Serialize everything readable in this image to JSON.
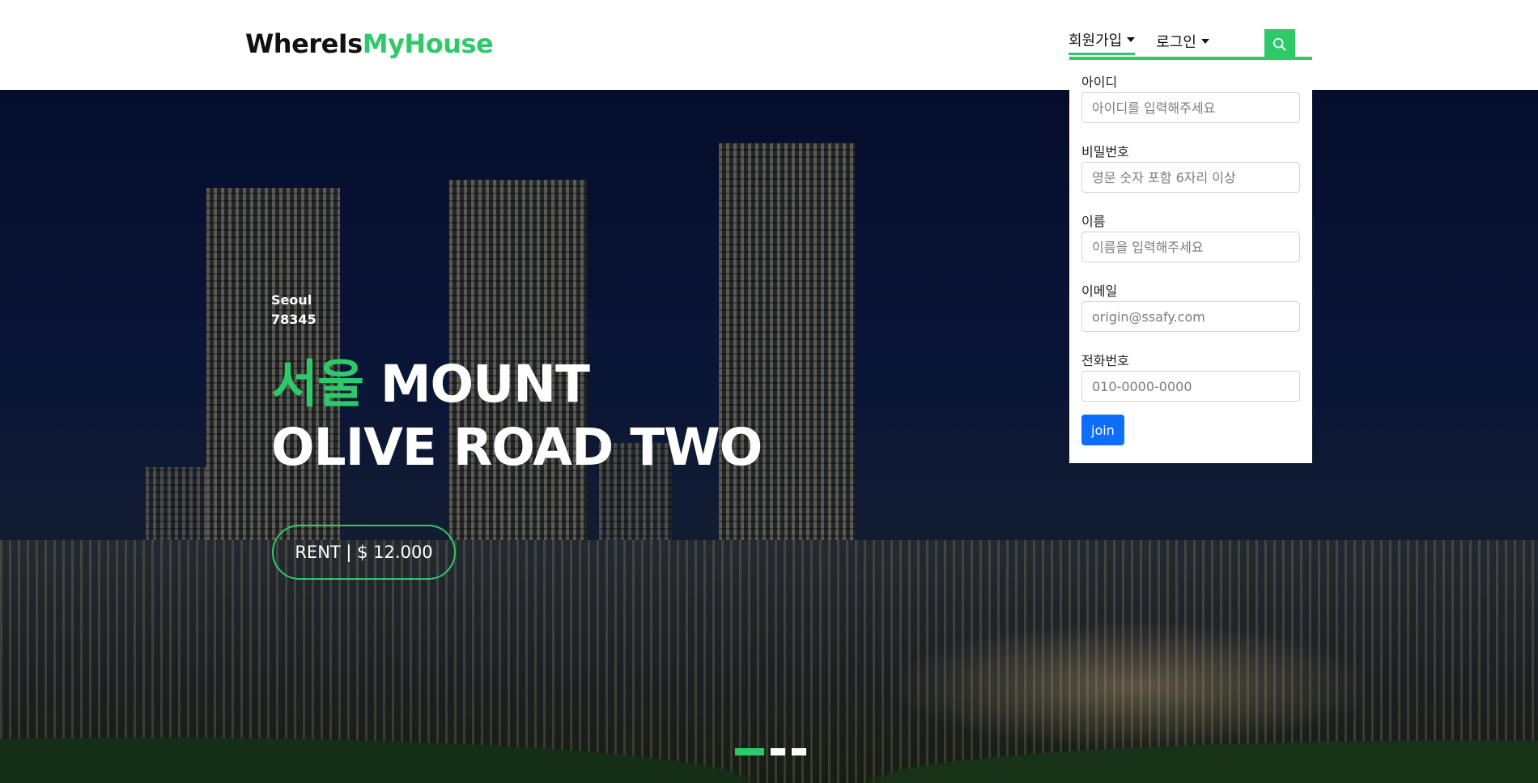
{
  "header": {
    "logo_part1": "WhereIs",
    "logo_part2": "MyHouse",
    "nav": {
      "signup_label": "회원가입",
      "login_label": "로그인"
    },
    "search_icon": "search-icon"
  },
  "signup_form": {
    "fields": [
      {
        "label": "아이디",
        "placeholder": "아이디를 입력해주세요"
      },
      {
        "label": "비밀번호",
        "placeholder": "영문 숫자 포함 6자리 이상"
      },
      {
        "label": "이름",
        "placeholder": "이름을 입력해주세요"
      },
      {
        "label": "이메일",
        "placeholder": "origin@ssafy.com"
      },
      {
        "label": "전화번호",
        "placeholder": "010-0000-0000"
      }
    ],
    "submit_label": "join"
  },
  "hero": {
    "city": "Seoul",
    "zip": "78345",
    "title_highlight": "서울",
    "title_line1_rest": " MOUNT",
    "title_line2": "OLIVE ROAD TWO",
    "price_button": "RENT | $ 12.000"
  },
  "colors": {
    "accent": "#2eca6a",
    "primary_button": "#0d6efd"
  }
}
